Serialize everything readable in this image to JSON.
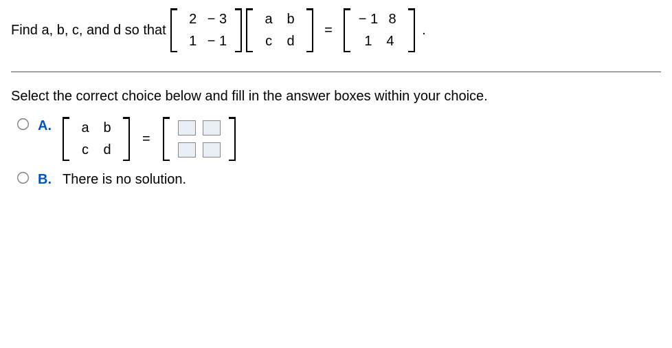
{
  "question": {
    "prompt_text": "Find a, b, c, and d so that",
    "matrix1": [
      [
        "2",
        "− 3"
      ],
      [
        "1",
        "− 1"
      ]
    ],
    "matrix2": [
      [
        "a",
        "b"
      ],
      [
        "c",
        "d"
      ]
    ],
    "equals": "=",
    "matrix3": [
      [
        "− 1",
        "8"
      ],
      [
        "1",
        "4"
      ]
    ],
    "period": "."
  },
  "instruction": "Select the correct choice below and fill in the answer boxes within your choice.",
  "choices": {
    "A": {
      "label": "A.",
      "lhs_matrix": [
        [
          "a",
          "b"
        ],
        [
          "c",
          "d"
        ]
      ],
      "equals": "="
    },
    "B": {
      "label": "B.",
      "text": "There is no solution."
    }
  }
}
